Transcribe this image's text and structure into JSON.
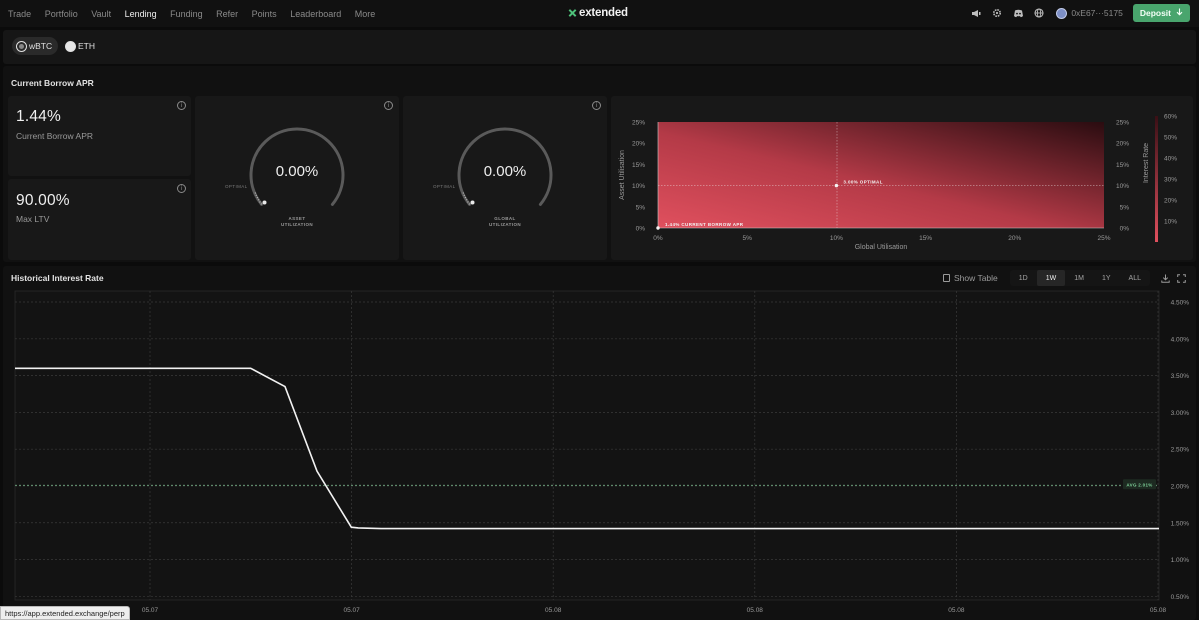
{
  "nav": {
    "items": [
      {
        "label": "Trade",
        "active": false
      },
      {
        "label": "Portfolio",
        "active": false
      },
      {
        "label": "Vault",
        "active": false
      },
      {
        "label": "Lending",
        "active": true
      },
      {
        "label": "Funding",
        "active": false
      },
      {
        "label": "Refer",
        "active": false
      },
      {
        "label": "Points",
        "active": false
      },
      {
        "label": "Leaderboard",
        "active": false
      },
      {
        "label": "More",
        "active": false
      }
    ],
    "logo_text": "extended",
    "wallet": "0xE67···5175",
    "deposit_label": "Deposit",
    "icons": [
      "megaphone-icon",
      "gear-icon",
      "discord-icon",
      "globe-icon"
    ]
  },
  "asset_tabs": [
    {
      "label": "wBTC",
      "active": true
    },
    {
      "label": "ETH",
      "active": false
    }
  ],
  "borrow": {
    "title": "Current Borrow APR",
    "apr_value": "1.44%",
    "apr_label": "Current Borrow APR",
    "ltv_value": "90.00%",
    "ltv_label": "Max LTV",
    "asset_gauge": {
      "value": "0.00%",
      "fraction": 0,
      "optimal_label": "OPTIMAL",
      "label_line1": "ASSET",
      "label_line2": "UTILIZATION"
    },
    "global_gauge": {
      "value": "0.00%",
      "fraction": 0,
      "optimal_label": "OPTIMAL",
      "label_line1": "GLOBAL",
      "label_line2": "UTILIZATION"
    }
  },
  "heatmap": {
    "xlabel": "Global Utilisation",
    "ylabel_left": "Asset Utilisation",
    "ylabel_right": "Interest Rate",
    "x_ticks": [
      "0%",
      "5%",
      "10%",
      "15%",
      "20%",
      "25%"
    ],
    "y_ticks": [
      "0%",
      "5%",
      "10%",
      "15%",
      "20%",
      "25%"
    ],
    "rate_ticks": [
      "10%",
      "20%",
      "30%",
      "40%",
      "50%",
      "60%"
    ],
    "optimal_label": "3.00% OPTIMAL",
    "optimal_point": {
      "x": 10,
      "y": 10
    },
    "current_label": "1.44% CURRENT BORROW APR",
    "current_point": {
      "x": 0,
      "y": 0
    },
    "colors": {
      "low": "#e0505e",
      "high": "#2a0c10"
    }
  },
  "history": {
    "title": "Historical Interest Rate",
    "show_table_label": "Show Table",
    "ranges": [
      {
        "label": "1D",
        "active": false
      },
      {
        "label": "1W",
        "active": true
      },
      {
        "label": "1M",
        "active": false
      },
      {
        "label": "1Y",
        "active": false
      },
      {
        "label": "ALL",
        "active": false
      }
    ],
    "avg_label": "AVG 2.01%"
  },
  "chart_data": {
    "type": "line",
    "title": "Historical Interest Rate",
    "xlabel": "",
    "ylabel": "",
    "x_tick_labels": [
      "05.07",
      "05.07",
      "05.08",
      "05.08",
      "05.08",
      "05.08"
    ],
    "y_ticks": [
      0.5,
      1.0,
      1.5,
      2.0,
      2.5,
      3.0,
      3.5,
      4.0,
      4.5
    ],
    "y_tick_labels": [
      "0.50%",
      "1.00%",
      "1.50%",
      "2.00%",
      "2.50%",
      "3.00%",
      "3.50%",
      "4.00%",
      "4.50%"
    ],
    "ylim": [
      0.45,
      4.65
    ],
    "xlim": [
      0,
      1
    ],
    "grid": true,
    "average": 2.01,
    "series": [
      {
        "x": [
          0.0,
          0.07,
          0.14,
          0.206,
          0.236,
          0.264,
          0.294,
          0.3,
          0.32,
          0.5,
          0.7,
          0.9,
          1.0
        ],
        "values": [
          3.6,
          3.6,
          3.6,
          3.6,
          3.35,
          2.2,
          1.44,
          1.43,
          1.42,
          1.42,
          1.42,
          1.42,
          1.42
        ]
      }
    ]
  },
  "status_url": "https://app.extended.exchange/perp"
}
